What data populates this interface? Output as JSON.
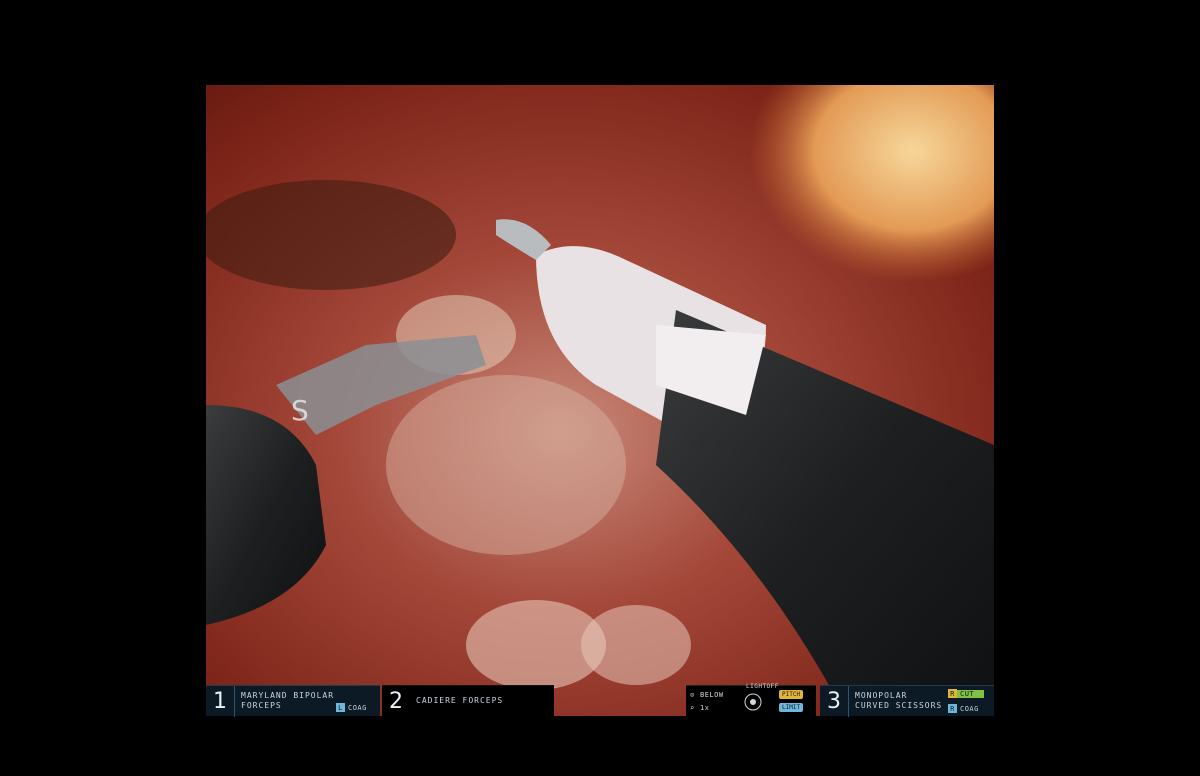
{
  "arms": [
    {
      "number": "1",
      "name_line1": "MARYLAND BIPOLAR",
      "name_line2": "FORCEPS",
      "energy_key": "L",
      "energy_label": "COAG"
    },
    {
      "number": "2",
      "name_line1": "CADIERE FORCEPS"
    },
    {
      "number": "3",
      "name_line1": "MONOPOLAR",
      "name_line2": "CURVED SCISSORS",
      "energy_key": "R",
      "energy_label_top": "CUT",
      "energy_label_bottom": "COAG"
    }
  ],
  "center": {
    "camera_label": "BELOW",
    "zoom": "1x",
    "top_label": "LIGHTOFF",
    "pill_top": "PITCH",
    "pill_bottom": "LIMIT"
  },
  "colors": {
    "hud_bg": "#0b1a25",
    "hud_border": "#2b5670",
    "cut_green": "#7fc241",
    "pitch_yellow": "#e1b43a",
    "limit_blue": "#6fb6d9"
  }
}
